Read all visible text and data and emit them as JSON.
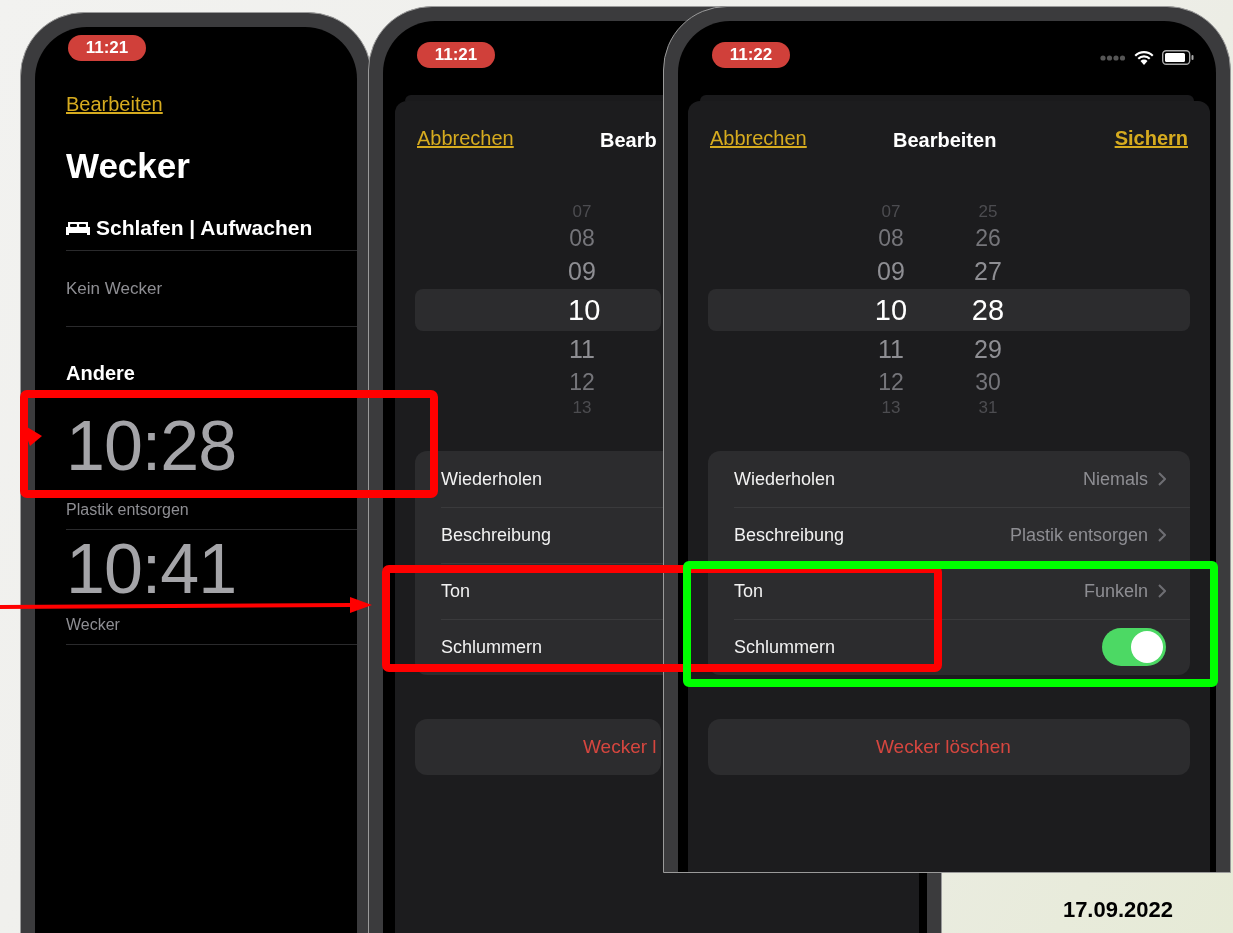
{
  "phones": [
    {
      "kind": "alarm_list",
      "status_time": "11:21",
      "edit_link": "Bearbeiten",
      "title": "Wecker",
      "sleep_header": "Schlafen | Aufwachen",
      "sleep_status": "Kein Wecker",
      "section": "Andere",
      "alarms": [
        {
          "time": "10:28",
          "label": "Plastik entsorgen"
        },
        {
          "time": "10:41",
          "label": "Wecker"
        }
      ]
    },
    {
      "kind": "edit_sheet",
      "status_time": "11:21",
      "cancel": "Abbrechen",
      "title": "Bearb",
      "picker": [
        {
          "hour": "07",
          "selected": false
        },
        {
          "hour": "08",
          "selected": false
        },
        {
          "hour": "09",
          "selected": false
        },
        {
          "hour": "10",
          "selected": true
        },
        {
          "hour": "11",
          "selected": false
        },
        {
          "hour": "12",
          "selected": false
        },
        {
          "hour": "13",
          "selected": false
        }
      ],
      "rows": [
        {
          "kind": "link",
          "label": "Wiederholen"
        },
        {
          "kind": "link",
          "label": "Beschreibung"
        },
        {
          "kind": "link",
          "label": "Ton"
        },
        {
          "kind": "link",
          "label": "Schlummern"
        }
      ],
      "delete": "Wecker l"
    },
    {
      "kind": "edit_sheet",
      "status_time": "11:22",
      "status_icons": true,
      "cancel": "Abbrechen",
      "title": "Bearbeiten",
      "save": "Sichern",
      "picker": [
        {
          "hour": "07",
          "minute": "25",
          "selected": false
        },
        {
          "hour": "08",
          "minute": "26",
          "selected": false
        },
        {
          "hour": "09",
          "minute": "27",
          "selected": false
        },
        {
          "hour": "10",
          "minute": "28",
          "selected": true
        },
        {
          "hour": "11",
          "minute": "29",
          "selected": false
        },
        {
          "hour": "12",
          "minute": "30",
          "selected": false
        },
        {
          "hour": "13",
          "minute": "31",
          "selected": false
        }
      ],
      "rows": [
        {
          "kind": "link",
          "label": "Wiederholen",
          "value": "Niemals"
        },
        {
          "kind": "link",
          "label": "Beschreibung",
          "value": "Plastik entsorgen"
        },
        {
          "kind": "link",
          "label": "Ton",
          "value": "Funkeln"
        },
        {
          "kind": "toggle",
          "label": "Schlummern",
          "on": true
        }
      ],
      "delete": "Wecker löschen"
    }
  ],
  "date": "17.09.2022"
}
